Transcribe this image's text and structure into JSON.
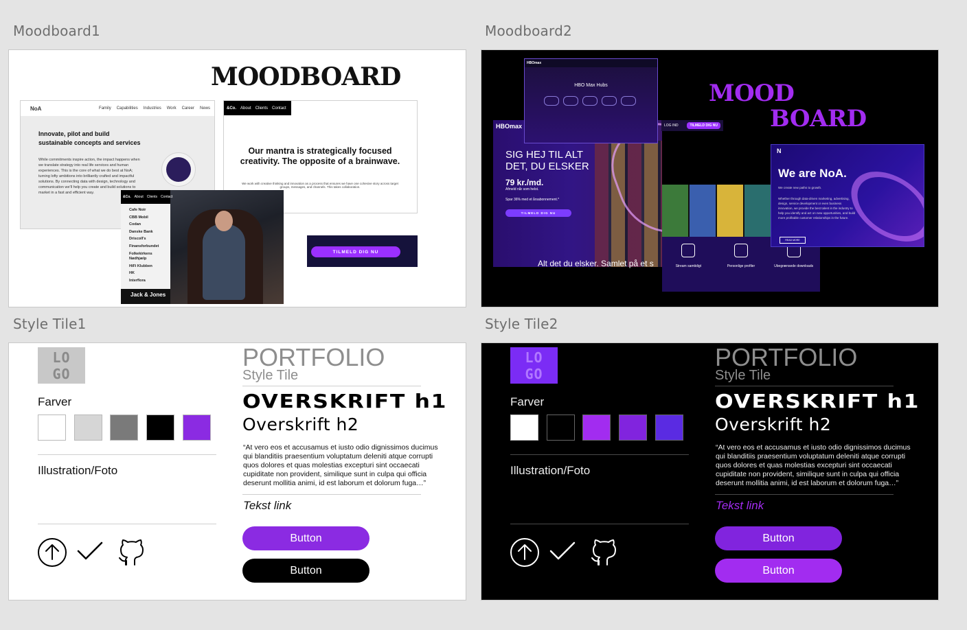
{
  "artboards": {
    "moodboard1": "Moodboard1",
    "moodboard2": "Moodboard2",
    "styletile1": "Style Tile1",
    "styletile2": "Style Tile2"
  },
  "moodboard1": {
    "title": "MOODBOARD",
    "noa": {
      "logo": "NoA",
      "nav": [
        "Family",
        "Capabilities",
        "Industries",
        "Work",
        "Career",
        "News"
      ],
      "headline": "Innovate, pilot and build sustainable concepts and services",
      "body": "While commitments inspire action, the impact happens when we translate strategy into real life services and human experiences. This is the core of what we do best at NoA; turning lofty ambitions into brilliantly crafted and impactful solutions. By connecting data with design, technology and communication we'll help you create and build solutions to market in a fast and efficient way."
    },
    "co": {
      "logo": "&Co.",
      "nav": [
        "About",
        "Clients",
        "Contact"
      ],
      "mantra": "Our mantra is strategically focused creativity. The opposite of a brainwave.",
      "small": "We work with creative thinking and innovation as a process that ensures we have one cohesive story across target groups, messages, and channels. This takes collaboration."
    },
    "menu": {
      "logo": "&Co.",
      "nav": [
        "About",
        "Clients",
        "Contact"
      ],
      "items": [
        "Cafe Noir",
        "CBB Mobil",
        "Codan",
        "Danske Bank",
        "Driscoll's",
        "Finansforbundet",
        "Folkekirkens Nødhjælp",
        "HiFi Klubben",
        "HK",
        "Interflora"
      ],
      "footer": "Jack & Jones"
    },
    "cta": "TILMELD DIG NU"
  },
  "moodboard2": {
    "title_line1": "MOOD",
    "title_line2": "BOARD",
    "hbo": {
      "brand": "HBOmax",
      "hubs_title": "HBO Max Hubs",
      "headline": "SIG HEJ TIL ALT DET, DU ELSKER",
      "price": "79 kr./md.",
      "cancel": "Afmeld når som helst.",
      "save": "Spar 36% med et årsabonnement.*",
      "cta": "TILMELD DIG NU",
      "login": "LOG IND",
      "tagline": "Alt det du elsker. Samlet på et s",
      "features": [
        "Stream samtidigt",
        "Personlige profiler",
        "Ubegrænsede downloads"
      ]
    },
    "noa": {
      "logo": "N",
      "headline": "We are NoA.",
      "sub": "We create new paths to growth.",
      "body": "Whether through data-driven marketing, advertising, design, service development or even business innovation, we provide the best talent in the industry to help you identify and act on new opportunities, and build more profitable customer relationships in the future.",
      "more": "READ MORE"
    }
  },
  "styletile1": {
    "logo_l1": "LO",
    "logo_l2": "GO",
    "title": "PORTFOLIO",
    "subtitle": "Style Tile",
    "colors_label": "Farver",
    "colors": [
      "#ffffff",
      "#d6d6d6",
      "#7a7a7a",
      "#000000",
      "#8b2be2"
    ],
    "illustration_label": "Illustration/Foto",
    "h1": "OVERSKRIFT h1",
    "h2": "Overskrift h2",
    "quote": "“At vero eos et accusamus et iusto odio dignissimos ducimus qui blanditiis praesentium voluptatum deleniti atque corrupti quos dolores et quas molestias excepturi sint occaecati cupiditate non provident, similique sunt in culpa qui officia deserunt mollitia animi, id est laborum et dolorum fuga…”",
    "link": "Tekst link",
    "button1": "Button",
    "button2": "Button",
    "button1_color": "#8b2be2",
    "button2_color": "#000000",
    "icons": [
      "arrow-up-circle-icon",
      "check-icon",
      "github-icon"
    ]
  },
  "styletile2": {
    "logo_l1": "LO",
    "logo_l2": "GO",
    "title": "PORTFOLIO",
    "subtitle": "Style Tile",
    "colors_label": "Farver",
    "colors": [
      "#ffffff",
      "#000000",
      "#a22cf0",
      "#8124de",
      "#5a2be2"
    ],
    "illustration_label": "Illustration/Foto",
    "h1": "OVERSKRIFT h1",
    "h2": "Overskrift h2",
    "quote": "“At vero eos et accusamus et iusto odio dignissimos ducimus qui blanditiis praesentium voluptatum deleniti atque corrupti quos dolores et quas molestias excepturi sint occaecati cupiditate non provident, similique sunt in culpa qui officia deserunt mollitia animi, id est laborum et dolorum fuga…”",
    "link": "Tekst link",
    "button1": "Button",
    "button2": "Button",
    "button1_color": "#8124de",
    "button2_color": "#a22cf0",
    "icons": [
      "arrow-up-circle-icon",
      "check-icon",
      "github-icon"
    ]
  }
}
